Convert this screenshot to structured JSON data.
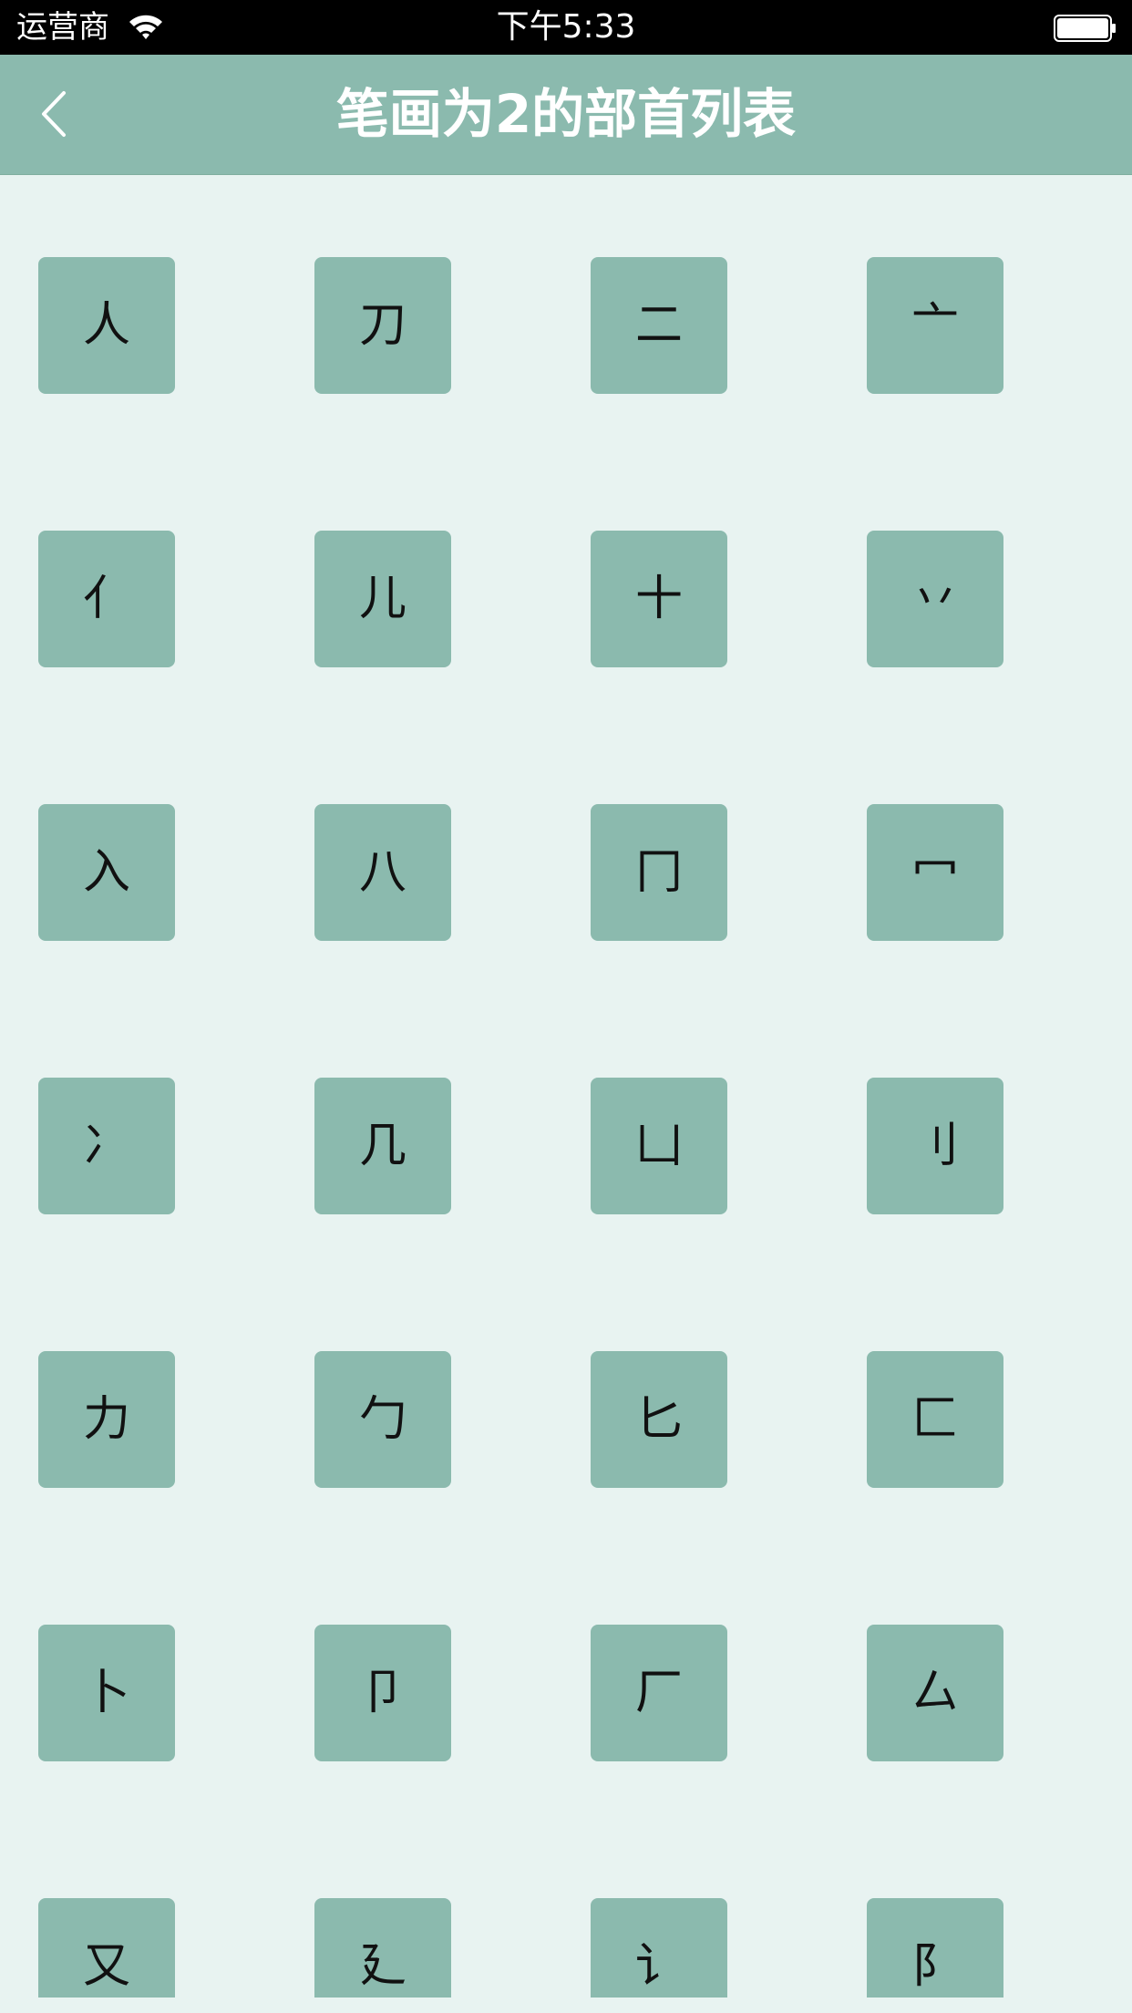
{
  "status_bar": {
    "carrier": "运营商",
    "time": "下午5:33",
    "wifi_icon": "wifi-icon",
    "battery_icon": "battery-icon"
  },
  "nav": {
    "title": "笔画为2的部首列表",
    "back_icon": "chevron-left-icon"
  },
  "colors": {
    "accent": "#8bbaae",
    "background": "#e8f3f1",
    "status_bar": "#000000",
    "title_text": "#ffffff",
    "tile_text": "#111111"
  },
  "radicals": [
    "人",
    "刀",
    "二",
    "亠",
    "亻",
    "儿",
    "十",
    "丷",
    "入",
    "八",
    "冂",
    "冖",
    "冫",
    "几",
    "凵",
    "刂",
    "力",
    "勹",
    "匕",
    "匚",
    "卜",
    "卩",
    "厂",
    "厶",
    "又",
    "廴",
    "讠",
    "阝"
  ]
}
